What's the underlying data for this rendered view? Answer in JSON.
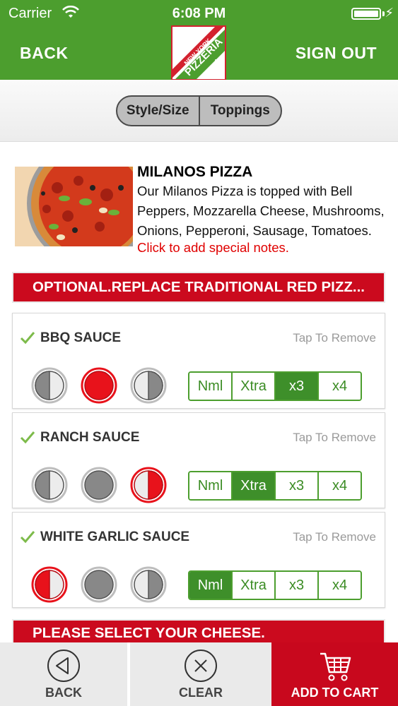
{
  "status_bar": {
    "carrier": "Carrier",
    "time": "6:08 PM",
    "charging_icon": "bolt-icon"
  },
  "header": {
    "back_label": "BACK",
    "signout_label": "SIGN OUT",
    "logo_text": "PIZZERIA",
    "logo_subtext": "NEW YORK",
    "brand_color": "#4c9e2e",
    "accent_color": "#cb0a1e"
  },
  "tabs": [
    {
      "label": "Style/Size"
    },
    {
      "label": "Toppings"
    }
  ],
  "product": {
    "title": "MILANOS PIZZA",
    "description": "Our Milanos Pizza is topped with Bell Peppers, Mozzarella Cheese, Mushrooms, Onions, Pepperoni, Sausage, Tomatoes.",
    "notes_link": "Click to add special notes."
  },
  "section_optional": "OPTIONAL.REPLACE TRADITIONAL RED PIZZ...",
  "section_cheese": "PLEASE SELECT YOUR CHEESE.",
  "sauces": [
    {
      "name": "BBQ SAUCE",
      "remove_label": "Tap To Remove",
      "coverage_selected": "whole",
      "quantity_options": [
        "Nml",
        "Xtra",
        "x3",
        "x4"
      ],
      "quantity_selected": "x3"
    },
    {
      "name": "RANCH SAUCE",
      "remove_label": "Tap To Remove",
      "coverage_selected": "right",
      "quantity_options": [
        "Nml",
        "Xtra",
        "x3",
        "x4"
      ],
      "quantity_selected": "Xtra"
    },
    {
      "name": "WHITE GARLIC SAUCE",
      "remove_label": "Tap To Remove",
      "coverage_selected": "left",
      "quantity_options": [
        "Nml",
        "Xtra",
        "x3",
        "x4"
      ],
      "quantity_selected": "Nml"
    }
  ],
  "bottom_bar": {
    "back_label": "BACK",
    "clear_label": "CLEAR",
    "cart_label": "ADD TO CART"
  }
}
